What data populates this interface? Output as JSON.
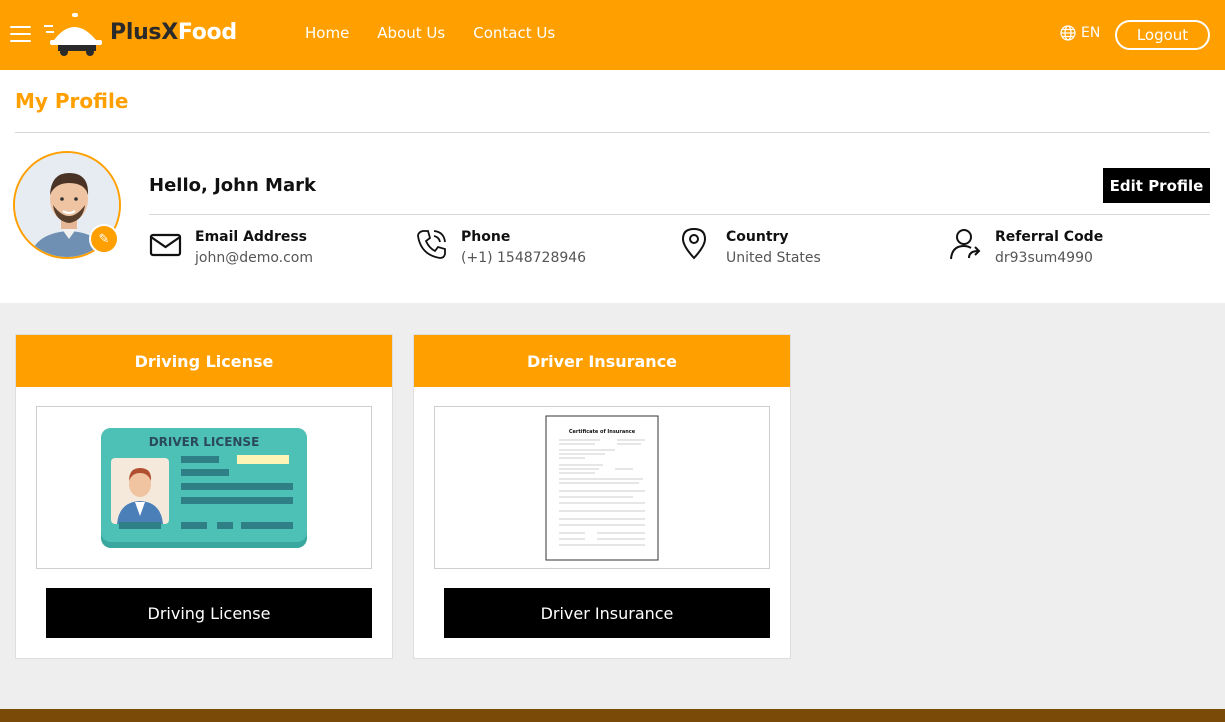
{
  "header": {
    "logo_part1": "PlusX",
    "logo_part2": "Food",
    "nav": [
      "Home",
      "About Us",
      "Contact Us"
    ],
    "language": "EN",
    "logout_label": "Logout"
  },
  "profile": {
    "page_title": "My Profile",
    "greeting": "Hello, John Mark",
    "edit_profile_label": "Edit Profile",
    "email_label": "Email Address",
    "email_value": "john@demo.com",
    "phone_label": "Phone",
    "phone_value": "(+1) 1548728946",
    "country_label": "Country",
    "country_value": "United States",
    "referral_label": "Referral Code",
    "referral_value": "dr93sum4990"
  },
  "documents": {
    "license_title": "Driving License",
    "license_image_text": "DRIVER LICENSE",
    "license_button": "Driving License",
    "insurance_title": "Driver Insurance",
    "insurance_image_text": "Certificate of Insurance",
    "insurance_button": "Driver Insurance"
  },
  "colors": {
    "accent": "#ff9f00",
    "button": "#000000",
    "footer": "#7a4a08"
  }
}
